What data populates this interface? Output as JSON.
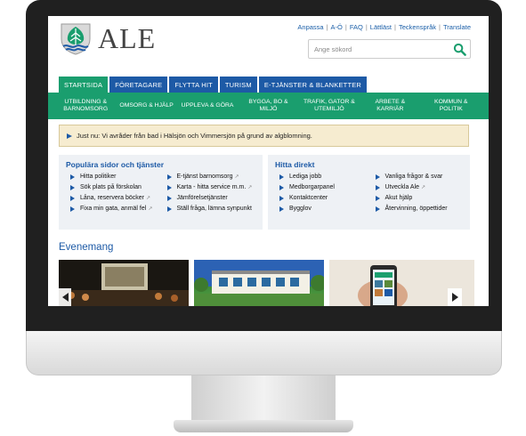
{
  "brand": {
    "name": "ALE",
    "logo_icon": "tree-shield-icon",
    "green": "#1a9e6e",
    "blue": "#1d5aa6"
  },
  "top_links": [
    "Anpassa",
    "A-Ö",
    "FAQ",
    "Lättläst",
    "Teckenspråk",
    "Translate"
  ],
  "search": {
    "placeholder": "Ange sökord",
    "icon": "search-icon"
  },
  "tabs": [
    "STARTSIDA",
    "FÖRETAGARE",
    "FLYTTA HIT",
    "TURISM",
    "E-TJÄNSTER & BLANKETTER"
  ],
  "subnav": [
    "UTBILDNING & BARNOMSORG",
    "OMSORG & HJÄLP",
    "UPPLEVA & GÖRA",
    "BYGGA, BO & MILJÖ",
    "TRAFIK, GATOR & UTEMILJÖ",
    "ARBETE & KARRIÄR",
    "KOMMUN & POLITIK"
  ],
  "notice": {
    "text": "Just nu: Vi avråder från bad i Hälsjön och Vimmersjön på grund av algblomning."
  },
  "popular": {
    "title": "Populära sidor och tjänster",
    "links": [
      "Hitta politiker",
      "E-tjänst barnomsorg",
      "Sök plats på förskolan",
      "Karta - hitta service m.m.",
      "Låna, reservera böcker",
      "Jämförelsetjänster",
      "Fixa min gata, anmäl fel",
      "Ställ fråga, lämna synpunkt"
    ]
  },
  "quick": {
    "title": "Hitta direkt",
    "links": [
      "Lediga jobb",
      "Vanliga frågor & svar",
      "Medborgarpanel",
      "Utveckla Ale",
      "Kontaktcenter",
      "Akut hjälp",
      "Bygglov",
      "Återvinning, öppettider"
    ]
  },
  "events": {
    "title": "Evenemang"
  }
}
